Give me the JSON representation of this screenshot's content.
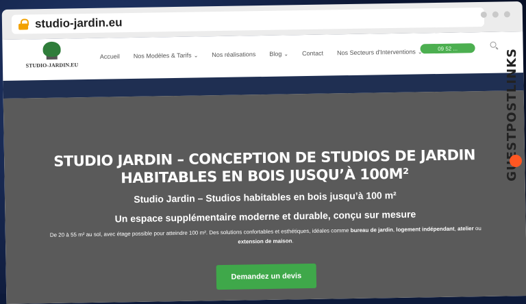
{
  "browser": {
    "url": "studio-jardin.eu"
  },
  "nav": {
    "logo_text": "STUDIO-JARDIN.EU",
    "items": [
      {
        "label": "Accueil",
        "has_chevron": false
      },
      {
        "label": "Nos Modèles & Tarifs",
        "has_chevron": true
      },
      {
        "label": "Nos réalisations",
        "has_chevron": false
      },
      {
        "label": "Blog",
        "has_chevron": true
      },
      {
        "label": "Contact",
        "has_chevron": false
      },
      {
        "label": "Nos Secteurs d'Interventions",
        "has_chevron": true
      }
    ],
    "phone_label": "09 52 ..."
  },
  "hero": {
    "title": "Studio Jardin – Conception de studios de jardin habitables en bois jusqu’à 100m²",
    "subtitle1": "Studio Jardin – Studios habitables en bois jusqu’à 100 m²",
    "subtitle2": "Un espace supplémentaire moderne et durable, conçu sur mesure",
    "para_parts": {
      "a": "De 20 à 55 m² au sol, avec étage possible pour atteindre 100 m². Des solutions confortables et esthétiques, idéales comme ",
      "b1": "bureau de jardin",
      "c": ", ",
      "b2": "logement indépendant",
      "d": ", ",
      "b3": "atelier",
      "e": " ou ",
      "b4": "extension de maison",
      "f": "."
    },
    "cta_label": "Demandez un devis"
  },
  "sidebrand": {
    "text": "GUESTPOSTLINKS"
  },
  "colors": {
    "accent": "#3fa84a",
    "lock": "#f2a100",
    "hero_bg": "#5a5a5a"
  }
}
